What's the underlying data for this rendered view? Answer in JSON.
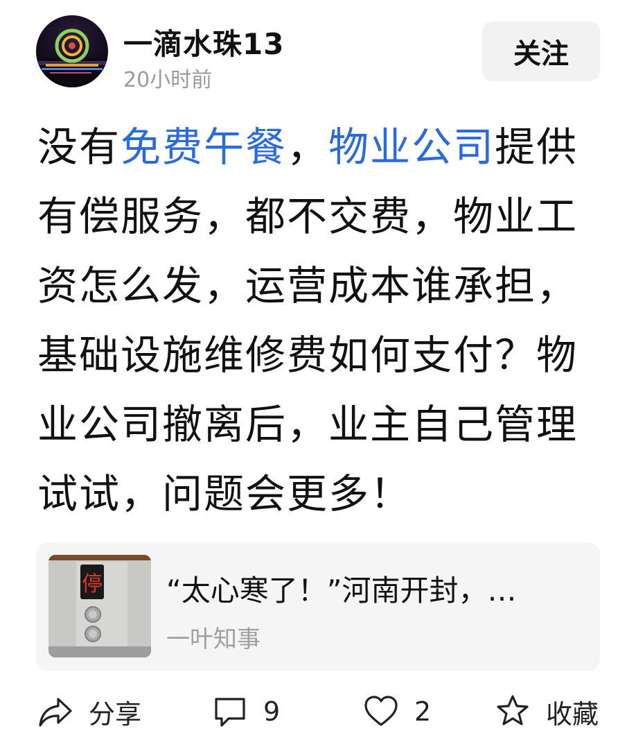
{
  "author": {
    "name": "一滴水珠13",
    "time": "20小时前",
    "follow_label": "关注"
  },
  "post": {
    "prefix": "没有",
    "link1": "免费午餐",
    "sep": "，",
    "link2": "物业公司",
    "rest": "提供有偿服务，都不交费，物业工资怎么发，运营成本谁承担，基础设施维修费如何支付？物业公司撤离后，业主自己管理试试，问题会更多！"
  },
  "article": {
    "title": "“太心寒了！”河南开封，…",
    "source": "一叶知事"
  },
  "actions": {
    "share_label": "分享",
    "comment_count": "9",
    "like_count": "2",
    "collect_label": "收藏"
  },
  "colors": {
    "link": "#2a6ad9",
    "secondary_text": "#9a9a9a"
  }
}
